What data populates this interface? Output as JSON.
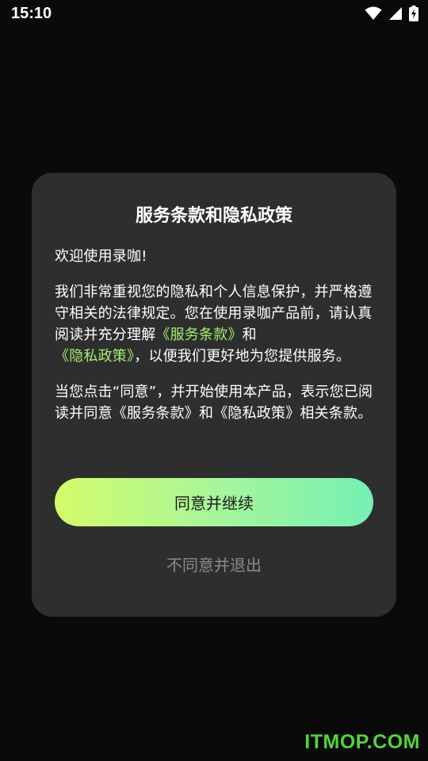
{
  "status_bar": {
    "time": "15:10"
  },
  "dialog": {
    "title": "服务条款和隐私政策",
    "welcome": "欢迎使用录咖!",
    "body": {
      "part1": "我们非常重视您的隐私和个人信息保护，并严格遵守相关的法律规定。您在使用录咖产品前，请认真阅读并充分理解",
      "terms_link": "《服务条款》",
      "and": "和",
      "privacy_link": "《隐私政策》",
      "part2": "，以便我们更好地为您提供服务。"
    },
    "confirm_text": "当您点击“同意”，并开始使用本产品，表示您已阅读并同意《服务条款》和《隐私政策》相关条款。",
    "agree_label": "同意并继续",
    "disagree_label": "不同意并退出"
  },
  "watermark": "ITMOP.COM",
  "colors": {
    "background": "#0a0a0a",
    "dialog": "#2e2e2e",
    "link": "#a4ef6e",
    "button_gradient_start": "#d4fb6a",
    "button_gradient_end": "#74f0b4",
    "watermark": "#55d23c"
  },
  "icons": [
    "wifi-icon",
    "cellular-signal-icon",
    "battery-charging-icon"
  ]
}
